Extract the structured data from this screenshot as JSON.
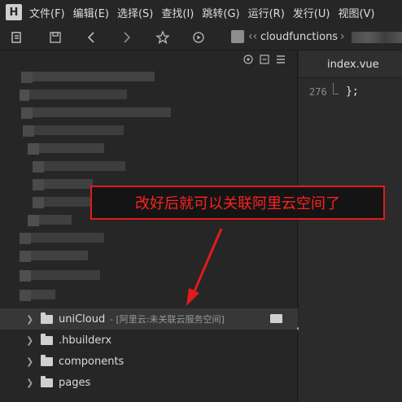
{
  "menubar": {
    "logo": "H",
    "items": [
      "文件(F)",
      "编辑(E)",
      "选择(S)",
      "查找(I)",
      "跳转(G)",
      "运行(R)",
      "发行(U)",
      "视图(V)"
    ]
  },
  "toolbar": {
    "icons": [
      "history-icon",
      "save-icon",
      "back-icon",
      "forward-icon",
      "star-icon",
      "run-icon"
    ],
    "breadcrumb_folder": "cloudfunctions",
    "breadcrumb_sep": "‹‹"
  },
  "explorer": {
    "header_icons": [
      "target-icon",
      "collapse-all-icon",
      "menu-icon"
    ],
    "items": [
      {
        "label": "uniCloud",
        "hint": "- [阿里云:未关联云服务空间]",
        "selected": true
      },
      {
        "label": ".hbuilderx",
        "hint": "",
        "selected": false
      },
      {
        "label": "components",
        "hint": "",
        "selected": false
      },
      {
        "label": "pages",
        "hint": "",
        "selected": false
      }
    ]
  },
  "editor": {
    "tab_label": "index.vue",
    "line_number": "276",
    "code": "};"
  },
  "annotation": {
    "text": "改好后就可以关联阿里云空间了",
    "color": "#e31a1a"
  }
}
